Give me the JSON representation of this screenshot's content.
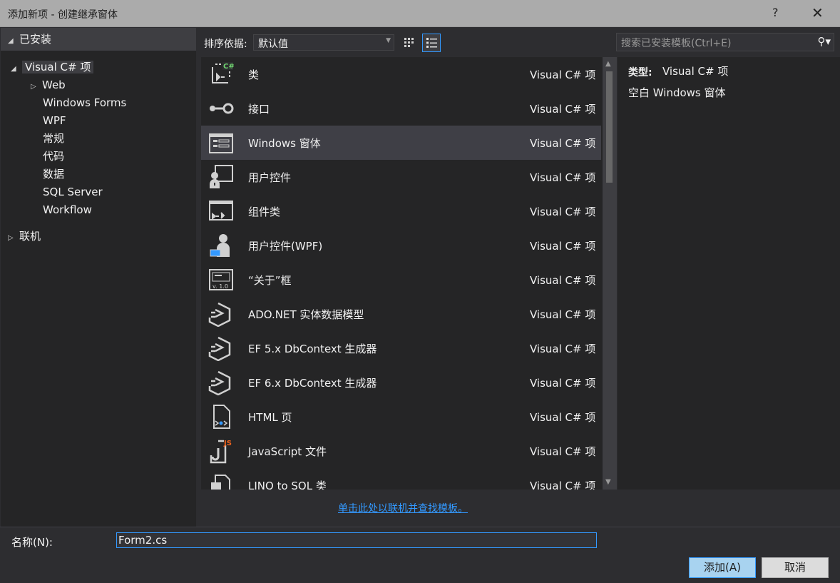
{
  "window": {
    "title": "添加新项 - 创建继承窗体",
    "help_label": "?",
    "close_label": "✕"
  },
  "tree": {
    "installed_header": "已安装",
    "root": "Visual C# 项",
    "children": [
      "Web",
      "Windows Forms",
      "WPF",
      "常规",
      "代码",
      "数据",
      "SQL Server",
      "Workflow"
    ],
    "online": "联机"
  },
  "toolbar": {
    "sort_label": "排序依据:",
    "sort_value": "默认值",
    "search_placeholder": "搜索已安装模板(Ctrl+E)"
  },
  "templates": [
    {
      "name": "类",
      "type": "Visual C# 项",
      "icon": "class-icon"
    },
    {
      "name": "接口",
      "type": "Visual C# 项",
      "icon": "interface-icon"
    },
    {
      "name": "Windows 窗体",
      "type": "Visual C# 项",
      "icon": "windows-form-icon",
      "selected": true
    },
    {
      "name": "用户控件",
      "type": "Visual C# 项",
      "icon": "user-control-icon"
    },
    {
      "name": "组件类",
      "type": "Visual C# 项",
      "icon": "component-class-icon"
    },
    {
      "name": "用户控件(WPF)",
      "type": "Visual C# 项",
      "icon": "wpf-user-control-icon"
    },
    {
      "name": "“关于”框",
      "type": "Visual C# 项",
      "icon": "about-box-icon"
    },
    {
      "name": "ADO.NET 实体数据模型",
      "type": "Visual C# 项",
      "icon": "data-model-icon"
    },
    {
      "name": "EF 5.x DbContext 生成器",
      "type": "Visual C# 项",
      "icon": "dbcontext-icon"
    },
    {
      "name": "EF 6.x DbContext 生成器",
      "type": "Visual C# 项",
      "icon": "dbcontext-icon"
    },
    {
      "name": "HTML 页",
      "type": "Visual C# 项",
      "icon": "html-page-icon"
    },
    {
      "name": "JavaScript 文件",
      "type": "Visual C# 项",
      "icon": "javascript-file-icon"
    },
    {
      "name": "LINQ to SQL 类",
      "type": "Visual C# 项",
      "icon": "linq-to-sql-icon"
    }
  ],
  "details": {
    "type_label": "类型:",
    "type_value": "Visual C# 项",
    "description": "空白 Windows 窗体"
  },
  "online_link": "单击此处以联机并查找模板。",
  "bottom": {
    "name_label": "名称(N):",
    "name_value": "Form2.cs",
    "add_button": "添加(A)",
    "cancel_button": "取消"
  },
  "colors": {
    "accent": "#3399ff",
    "selection": "#3f3f46",
    "background": "#2d2d30",
    "js_badge": "#f0641e"
  }
}
